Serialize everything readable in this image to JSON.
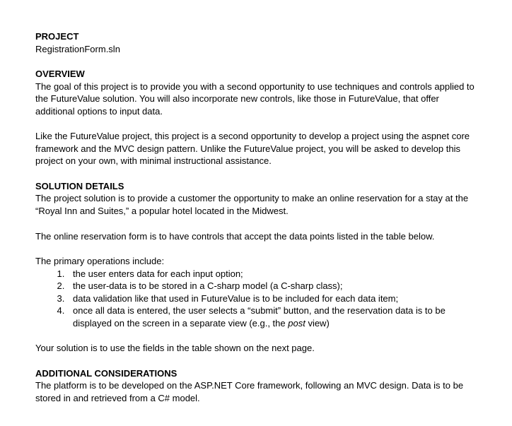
{
  "project": {
    "heading": "PROJECT",
    "name": "RegistrationForm.sln"
  },
  "overview": {
    "heading": "OVERVIEW",
    "para1": "The goal of this project is to provide you with a second opportunity to use techniques and controls applied to the FutureValue solution. You will also incorporate new controls, like those in FutureValue, that offer additional options to input data.",
    "para2": "Like the FutureValue project, this project is a second opportunity to develop a project using the aspnet core framework and the MVC design pattern. Unlike the FutureValue project, you will be asked to develop this project on your own, with minimal instructional assistance."
  },
  "solution": {
    "heading": "SOLUTION DETAILS",
    "para1": "The project solution is to provide a customer the opportunity to make an online reservation for a stay at the “Royal Inn and Suites,” a popular hotel located in the Midwest.",
    "para2": "The online reservation form is to have controls that accept the data points listed in the table below.",
    "ops_intro": "The primary operations include:",
    "ops": [
      "the user enters data for each input option;",
      "the user-data is to be stored in a C-sharp model (a C-sharp class);",
      "data validation like that used in FutureValue is to be included for each data item;"
    ],
    "op4_pre": "once all data is entered, the user selects a “submit” button, and the reservation data is to be displayed on the screen in a separate view (e.g., the ",
    "op4_italic": "post",
    "op4_post": " view)",
    "para3": "Your solution is to use the fields in the table shown on the next page."
  },
  "additional": {
    "heading": "ADDITIONAL CONSIDERATIONS",
    "para1": "The platform is to be developed on the ASP.NET Core framework, following an MVC design. Data is to be stored in and retrieved from a C# model."
  }
}
